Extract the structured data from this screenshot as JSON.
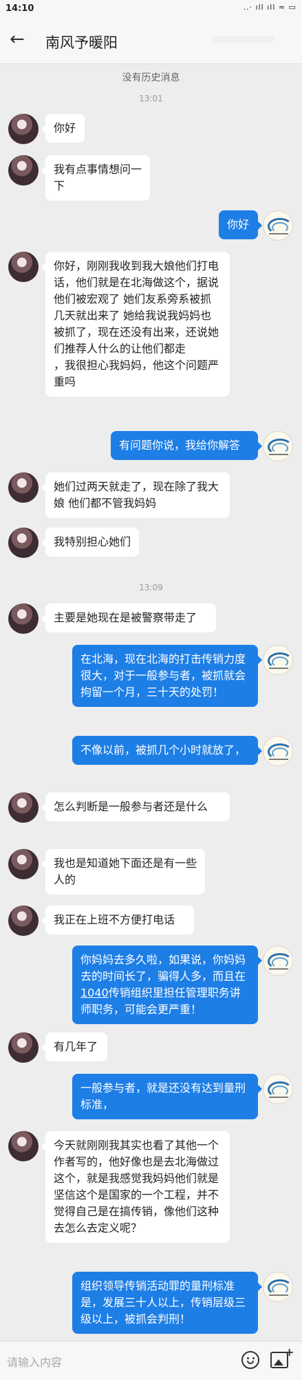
{
  "status_bar": {
    "time": "14:10",
    "indicators": "..· ıll ıll ≈ ▭"
  },
  "header": {
    "back_icon": "arrow-left-icon",
    "title": "南风予暖阳"
  },
  "notices": {
    "no_history": "没有历史消息",
    "time1": "13:01",
    "time2": "13:09"
  },
  "messages": [
    {
      "side": "left",
      "text": "你好"
    },
    {
      "side": "left",
      "text": "我有点事情想问一下"
    },
    {
      "side": "right",
      "text": "你好"
    },
    {
      "side": "left",
      "text": "你好，刚刚我收到我大娘他们打电话，他们就是在北海做这个，据说他们被宏观了 她们友系旁系被抓几天就出来了 她给我说我妈妈也被抓了，现在还没有出来，还说她们推荐人什么的让他们都走\n，我很担心我妈妈，他这个问题严重吗"
    },
    {
      "side": "right",
      "text": "有问题你说，我给你解答"
    },
    {
      "side": "left",
      "text": "她们过两天就走了，现在除了我大娘 他们都不管我妈妈"
    },
    {
      "side": "left",
      "text": "我特别担心她们"
    },
    {
      "side": "left",
      "text": "主要是她现在是被警察带走了"
    },
    {
      "side": "right",
      "text": "在北海，现在北海的打击传销力度很大，对于一般参与者，被抓就会拘留一个月，三十天的处罚！"
    },
    {
      "side": "right",
      "text": "不像以前，被抓几个小时就放了，"
    },
    {
      "side": "left",
      "text": "怎么判断是一般参与者还是什么"
    },
    {
      "side": "left",
      "text": "我也是知道她下面还是有一些人的"
    },
    {
      "side": "left",
      "text": "我正在上班不方便打电话"
    },
    {
      "side": "right",
      "text_before": "你妈妈去多久啦，如果说，你妈妈去的时间长了，骗得人多，而且在",
      "link": "1040",
      "text_after": "传销组织里担任管理职务讲师职务，可能会更严重！"
    },
    {
      "side": "left",
      "text": "有几年了"
    },
    {
      "side": "right",
      "text": "一般参与者，就是还没有达到量刑标准，"
    },
    {
      "side": "left",
      "text": "今天就刚刚我其实也看了其他一个作者写的，他好像也是去北海做过这个，就是我感觉我妈妈他们就是坚信这个是国家的一个工程，并不觉得自己是在搞传销，像他们这种去怎么去定义呢？"
    },
    {
      "side": "right",
      "text": "组织领导传销活动罪的量刑标准是，发展三十人以上，传销层级三级以上，被抓会判刑！"
    }
  ],
  "composer": {
    "placeholder": "请输入内容",
    "emoji_icon": "emoji-icon",
    "image_icon": "image-add-icon"
  }
}
